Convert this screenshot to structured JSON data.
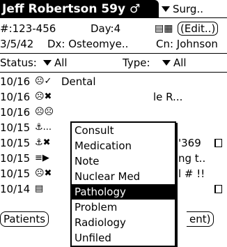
{
  "header": {
    "patient_title": "Jeff Robertson 59y ♂",
    "form_selector": "Surg.."
  },
  "info": {
    "mrn": "#:123-456",
    "day": "Day:4",
    "edit_label": "Edit..",
    "date": "3/5/42",
    "dx": "Dx: Osteomye..",
    "cn": "Cn: Johnson"
  },
  "filters": {
    "status_label": "Status:",
    "status_value": "All",
    "type_label": "Type:",
    "type_value": "All"
  },
  "list": [
    {
      "date": "10/16",
      "icons": "☹✓",
      "text": "Dental",
      "right": ""
    },
    {
      "date": "10/16",
      "icons": "☹✖",
      "text": "",
      "right": "le R..."
    },
    {
      "date": "10/16",
      "icons": "☹☹",
      "text": "",
      "right": ""
    },
    {
      "date": "10/15",
      "icons": "⚓...",
      "text": "",
      "right": ""
    },
    {
      "date": "10/15",
      "icons": "⚓✖",
      "text": "",
      "right": "'369"
    },
    {
      "date": "10/15",
      "icons": "≡▶",
      "text": "",
      "right": "ng t.."
    },
    {
      "date": "10/15",
      "icons": "☹✖",
      "text": "",
      "right": "l # !!"
    },
    {
      "date": "10/14",
      "icons": "▤",
      "text": "",
      "right": ""
    }
  ],
  "type_menu": {
    "items": [
      "Consult",
      "Medication",
      "Note",
      "Nuclear Med",
      "Pathology",
      "Problem",
      "Radiology",
      "Unfiled"
    ],
    "selected": "Pathology"
  },
  "buttons": {
    "patients": "Patients",
    "right": "ent)"
  }
}
